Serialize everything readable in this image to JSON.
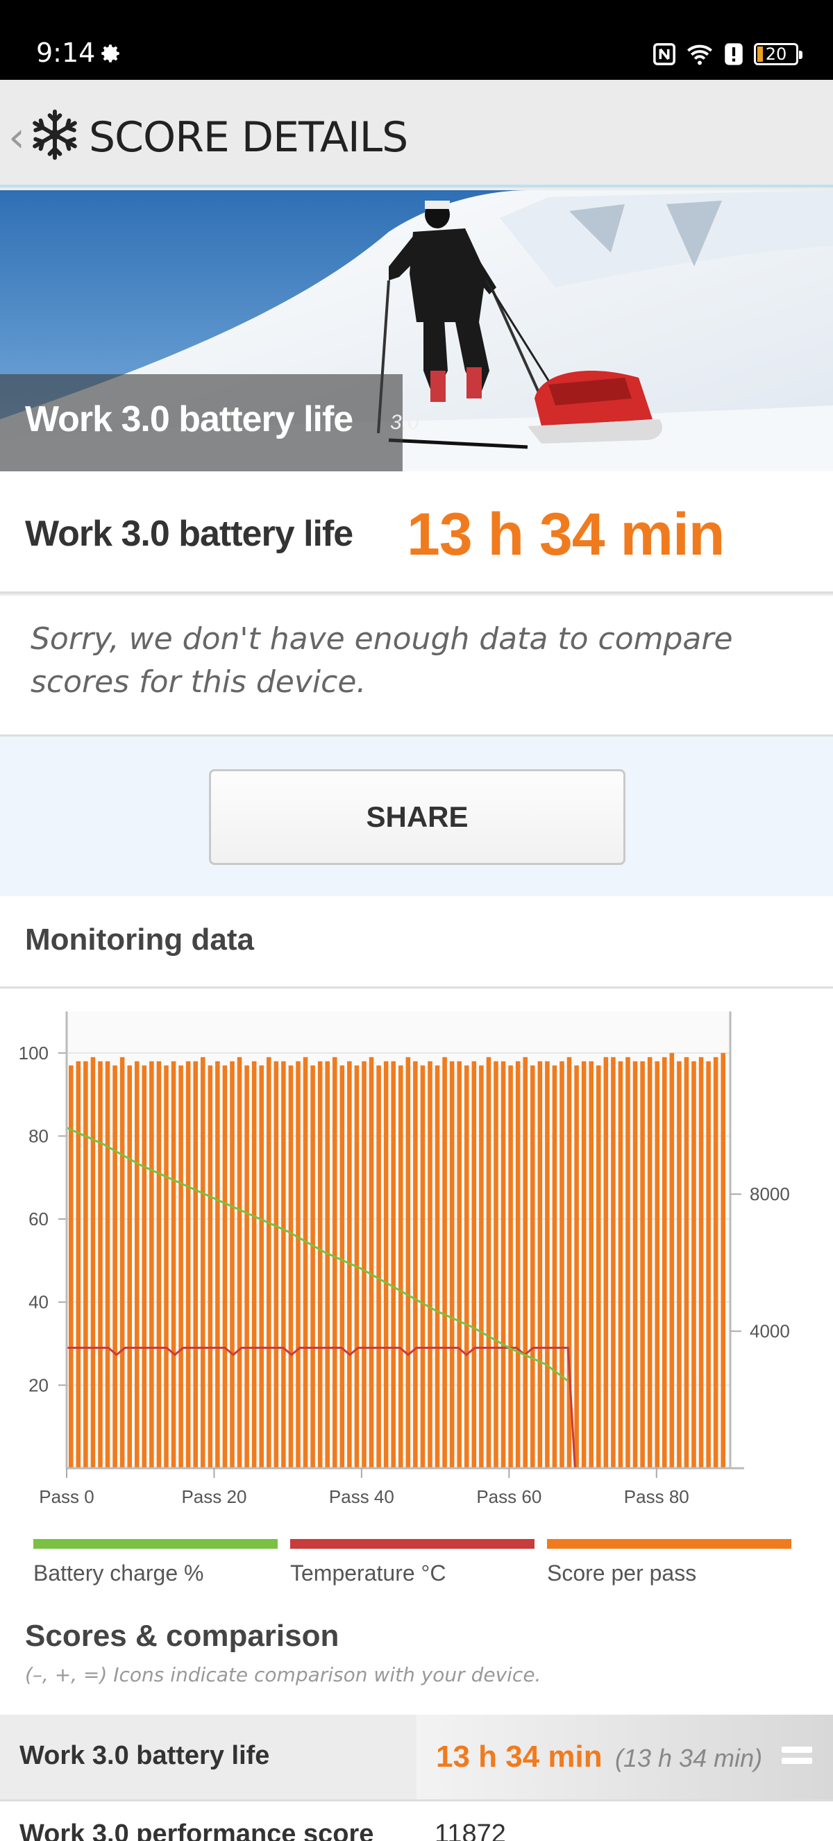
{
  "status_bar": {
    "time": "9:14",
    "icons": [
      "gear-icon",
      "nfc-icon",
      "wifi-icon",
      "alert-icon",
      "battery-icon"
    ],
    "battery_level": "20"
  },
  "app_bar": {
    "title": "SCORE DETAILS",
    "back_icon": "chevron-left-icon",
    "logo_icon": "snowflake-icon"
  },
  "hero": {
    "caption": "Work 3.0 battery life",
    "version": "3.0"
  },
  "result": {
    "label": "Work 3.0 battery life",
    "value": "13 h 34 min"
  },
  "notice": "Sorry, we don't have enough data to compare scores for this device.",
  "share_label": "SHARE",
  "monitoring": {
    "title": "Monitoring data"
  },
  "chart_data": {
    "type": "bar",
    "x_tick_labels": [
      "Pass 0",
      "Pass 20",
      "Pass 40",
      "Pass 60",
      "Pass 80"
    ],
    "left_axis": {
      "ticks": [
        "20",
        "40",
        "60",
        "80",
        "100"
      ],
      "ylim": [
        0,
        110
      ]
    },
    "right_axis": {
      "ticks": [
        "4000",
        "8000"
      ]
    },
    "xlim": [
      0,
      90
    ],
    "colors": {
      "battery": "#7ac143",
      "temperature": "#c83c3c",
      "score": "#f07b1e"
    },
    "series": [
      {
        "name": "Battery charge %",
        "type": "line",
        "x": [
          0,
          5,
          10,
          15,
          20,
          25,
          30,
          35,
          40,
          45,
          50,
          55,
          60,
          65,
          68
        ],
        "values": [
          82,
          78,
          73,
          69,
          65,
          61,
          57,
          52,
          48,
          43,
          38,
          34,
          29,
          25,
          21
        ]
      },
      {
        "name": "Temperature °C",
        "type": "line",
        "x": [
          0,
          68
        ],
        "values": [
          29,
          29
        ]
      },
      {
        "name": "Score per pass",
        "type": "bar",
        "count": 90,
        "values": [
          97,
          98,
          98,
          99,
          98,
          98,
          97,
          99,
          97,
          98,
          97,
          98,
          98,
          97,
          98,
          97,
          98,
          98,
          99,
          97,
          98,
          97,
          98,
          99,
          97,
          98,
          97,
          99,
          98,
          98,
          97,
          98,
          99,
          97,
          98,
          98,
          99,
          97,
          98,
          97,
          98,
          99,
          97,
          98,
          98,
          97,
          99,
          98,
          97,
          98,
          97,
          99,
          98,
          98,
          97,
          98,
          97,
          99,
          98,
          98,
          97,
          98,
          99,
          97,
          98,
          98,
          97,
          98,
          99,
          97,
          98,
          98,
          97,
          99,
          99,
          98,
          99,
          98,
          98,
          99,
          98,
          99,
          100,
          98,
          99,
          98,
          99,
          98,
          99,
          100
        ]
      }
    ],
    "legend": [
      "Battery charge %",
      "Temperature °C",
      "Score per pass"
    ]
  },
  "scores": {
    "title": "Scores & comparison",
    "subtitle": "(–, +, =) Icons indicate comparison with your device.",
    "rows": [
      {
        "label": "Work 3.0 battery life",
        "value": "13 h 34 min",
        "compare": "(13 h 34 min)",
        "icon": "equal-icon"
      },
      {
        "label": "Work 3.0 performance score",
        "value": "11872"
      }
    ]
  }
}
